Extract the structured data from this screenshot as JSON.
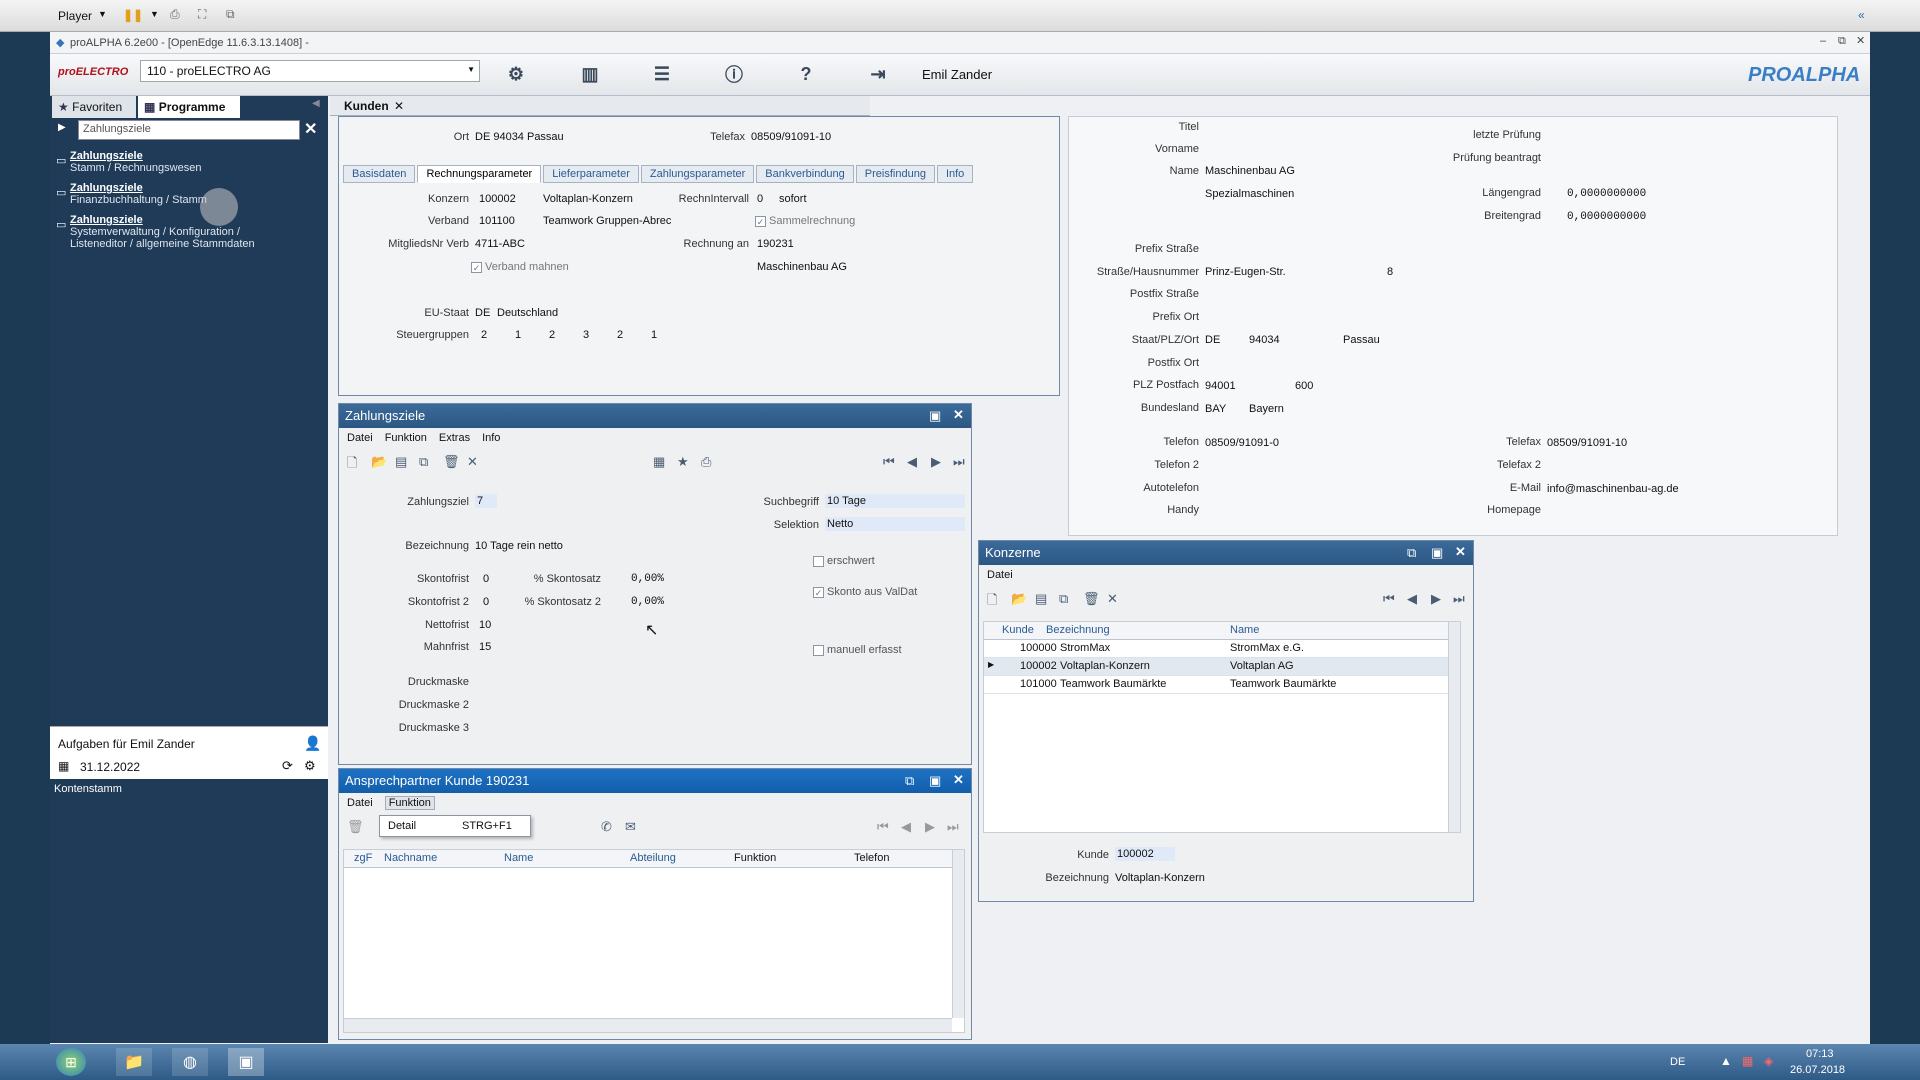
{
  "player": {
    "label": "Player"
  },
  "app": {
    "title": "proALPHA 6.2e00 - [OpenEdge 11.6.3.13.1408] -",
    "company_logo": "proELECTRO",
    "company_select": "110 - proELECTRO AG",
    "user": "Emil Zander",
    "brand": "PROALPHA"
  },
  "left": {
    "tabs": [
      {
        "label": "Favoriten"
      },
      {
        "label": "Programme"
      }
    ],
    "search_value": "Zahlungsziele",
    "tree": [
      {
        "title": "Zahlungsziele",
        "path": "Stamm / Rechnungswesen"
      },
      {
        "title": "Zahlungsziele",
        "path": "Finanzbuchhaltung / Stamm"
      },
      {
        "title": "Zahlungsziele",
        "path": "Systemverwaltung / Konfiguration /",
        "path2": "Listeneditor / allgemeine Stammdaten"
      }
    ],
    "tasks_title": "Aufgaben für Emil Zander",
    "tasks_date": "31.12.2022",
    "tasks_item": "Kontenstamm"
  },
  "kunden": {
    "tab_label": "Kunden",
    "ort_label": "Ort",
    "ort_value": "DE 94034 Passau",
    "telefax_label": "Telefax",
    "telefax_value": "08509/91091-10",
    "tabs": [
      "Basisdaten",
      "Rechnungsparameter",
      "Lieferparameter",
      "Zahlungsparameter",
      "Bankverbindung",
      "Preisfindung",
      "Info"
    ],
    "konzern_label": "Konzern",
    "konzern_id": "100002",
    "konzern_name": "Voltaplan-Konzern",
    "verband_label": "Verband",
    "verband_id": "101100",
    "verband_name": "Teamwork Gruppen-Abrec",
    "mitglied_label": "MitgliedsNr Verb",
    "mitglied_value": "4711-ABC",
    "verband_mahnen": "Verband mahnen",
    "rechnintervall_label": "RechnIntervall",
    "rechnintervall_id": "0",
    "rechnintervall_value": "sofort",
    "sammelrechnung": "Sammelrechnung",
    "rechnung_an_label": "Rechnung an",
    "rechnung_an_id": "190231",
    "rechnung_an_name": "Maschinenbau AG",
    "eu_label": "EU-Staat",
    "eu_code": "DE",
    "eu_name": "Deutschland",
    "steuer_label": "Steuergruppen",
    "steuergruppen": [
      "2",
      "1",
      "2",
      "3",
      "2",
      "1"
    ]
  },
  "address": {
    "titel": "Titel",
    "vorname": "Vorname",
    "name": "Name",
    "name_value": "Maschinenbau AG",
    "name_value2": "Spezialmaschinen",
    "letzte_pruefung": "letzte Prüfung",
    "pruefung_eingetragen": "Prüfung beantragt",
    "laengengrad": "Längengrad",
    "laengengrad_value": "0,0000000000",
    "breitengrad": "Breitengrad",
    "breitengrad_value": "0,0000000000",
    "prefix_strasse": "Prefix Straße",
    "strasse": "Straße/Hausnummer",
    "strasse_value": "Prinz-Eugen-Str.",
    "hausnr": "8",
    "postfix_strasse": "Postfix Straße",
    "prefix_ort": "Prefix Ort",
    "staat": "Staat/PLZ/Ort",
    "staat_code": "DE",
    "plz": "94034",
    "ort": "Passau",
    "postfix_ort": "Postfix Ort",
    "plz_postfach": "PLZ Postfach",
    "plz_postfach_value": "94001",
    "postfach": "600",
    "bundesland": "Bundesland",
    "bundesland_code": "BAY",
    "bundesland_name": "Bayern",
    "telefon": "Telefon",
    "telefon_value": "08509/91091-0",
    "telefax": "Telefax",
    "telefax_value": "08509/91091-10",
    "telefon2": "Telefon 2",
    "telefax2": "Telefax 2",
    "autotelefon": "Autotelefon",
    "email": "E-Mail",
    "email_value": "info@maschinenbau-ag.de",
    "handy": "Handy",
    "homepage": "Homepage"
  },
  "zahlungsziele": {
    "title": "Zahlungsziele",
    "menu": [
      "Datei",
      "Funktion",
      "Extras",
      "Info"
    ],
    "zahlungsziel_label": "Zahlungsziel",
    "zahlungsziel_value": "7",
    "bezeichnung_label": "Bezeichnung",
    "bezeichnung_value": "10 Tage rein netto",
    "suchbegriff_label": "Suchbegriff",
    "suchbegriff_value": "10 Tage",
    "selektion_label": "Selektion",
    "selektion_value": "Netto",
    "skontofrist_label": "Skontofrist",
    "skontofrist_value": "0",
    "skontosatz_label": "% Skontosatz",
    "skontosatz_value": "0,00%",
    "skontofrist2_label": "Skontofrist 2",
    "skontofrist2_value": "0",
    "skontosatz2_label": "% Skontosatz 2",
    "skontosatz2_value": "0,00%",
    "nettofrist_label": "Nettofrist",
    "nettofrist_value": "10",
    "mahnfrist_label": "Mahnfrist",
    "mahnfrist_value": "15",
    "erschwert": "erschwert",
    "skonto_valdat": "Skonto aus ValDat",
    "manuell": "manuell erfasst",
    "druckmaske": "Druckmaske",
    "druckmaske2": "Druckmaske 2",
    "druckmaske3": "Druckmaske 3"
  },
  "konzerne": {
    "title": "Konzerne",
    "menu": [
      "Datei"
    ],
    "columns": [
      "Kunde",
      "Bezeichnung",
      "Name"
    ],
    "rows": [
      {
        "kunde": "100000",
        "bez": "StromMax",
        "name": "StromMax e.G."
      },
      {
        "kunde": "100002",
        "bez": "Voltaplan-Konzern",
        "name": "Voltaplan AG"
      },
      {
        "kunde": "101000",
        "bez": "Teamwork Baumärkte",
        "name": "Teamwork Baumärkte"
      }
    ],
    "kunde_label": "Kunde",
    "kunde_value": "100002",
    "bez_label": "Bezeichnung",
    "bez_value": "Voltaplan-Konzern"
  },
  "ansprech": {
    "title": "Ansprechpartner Kunde 190231",
    "menu": [
      "Datei",
      "Funktion"
    ],
    "popup_item": "Detail",
    "popup_shortcut": "STRG+F1",
    "columns": [
      "zgF",
      "Nachname",
      "Name",
      "Abteilung",
      "Funktion",
      "Telefon"
    ]
  },
  "taskbar": {
    "lang": "DE",
    "time": "07:13",
    "date": "26.07.2018"
  }
}
